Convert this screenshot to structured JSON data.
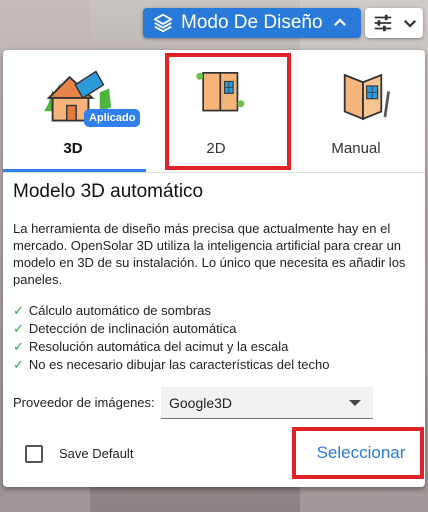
{
  "toolbar": {
    "mode_label": "Modo De Diseño",
    "mode_icon": "layers-icon",
    "chevron_icon": "chevron-up-icon",
    "settings_icon": "tune-icon",
    "settings_chevron": "chevron-down-icon"
  },
  "tabs": [
    {
      "label": "3D",
      "icon": "house-3d-icon",
      "active": true,
      "badge": "Aplicado"
    },
    {
      "label": "2D",
      "icon": "roof-2d-icon",
      "active": false
    },
    {
      "label": "Manual",
      "icon": "manual-roof-icon",
      "active": false
    }
  ],
  "section": {
    "title": "Modelo 3D automático",
    "description": "La herramienta de diseño más precisa que actualmente hay en el mercado. OpenSolar 3D utiliza la inteligencia artificial para crear un modelo en 3D de su instalación. Lo único que necesita es añadir los paneles.",
    "features": [
      "Cálculo automático de sombras",
      "Detección de inclinación automática",
      "Resolución automática del acimut y la escala",
      "No es necesario dibujar las características del techo"
    ],
    "check_glyph": "✓"
  },
  "provider": {
    "label": "Proveedor de imágenes:",
    "value": "Google3D"
  },
  "save_default": {
    "label": "Save Default",
    "checked": false
  },
  "actions": {
    "select_label": "Seleccionar"
  },
  "colors": {
    "accent": "#2f80ed",
    "highlight": "#e0232b",
    "check": "#27a845"
  }
}
